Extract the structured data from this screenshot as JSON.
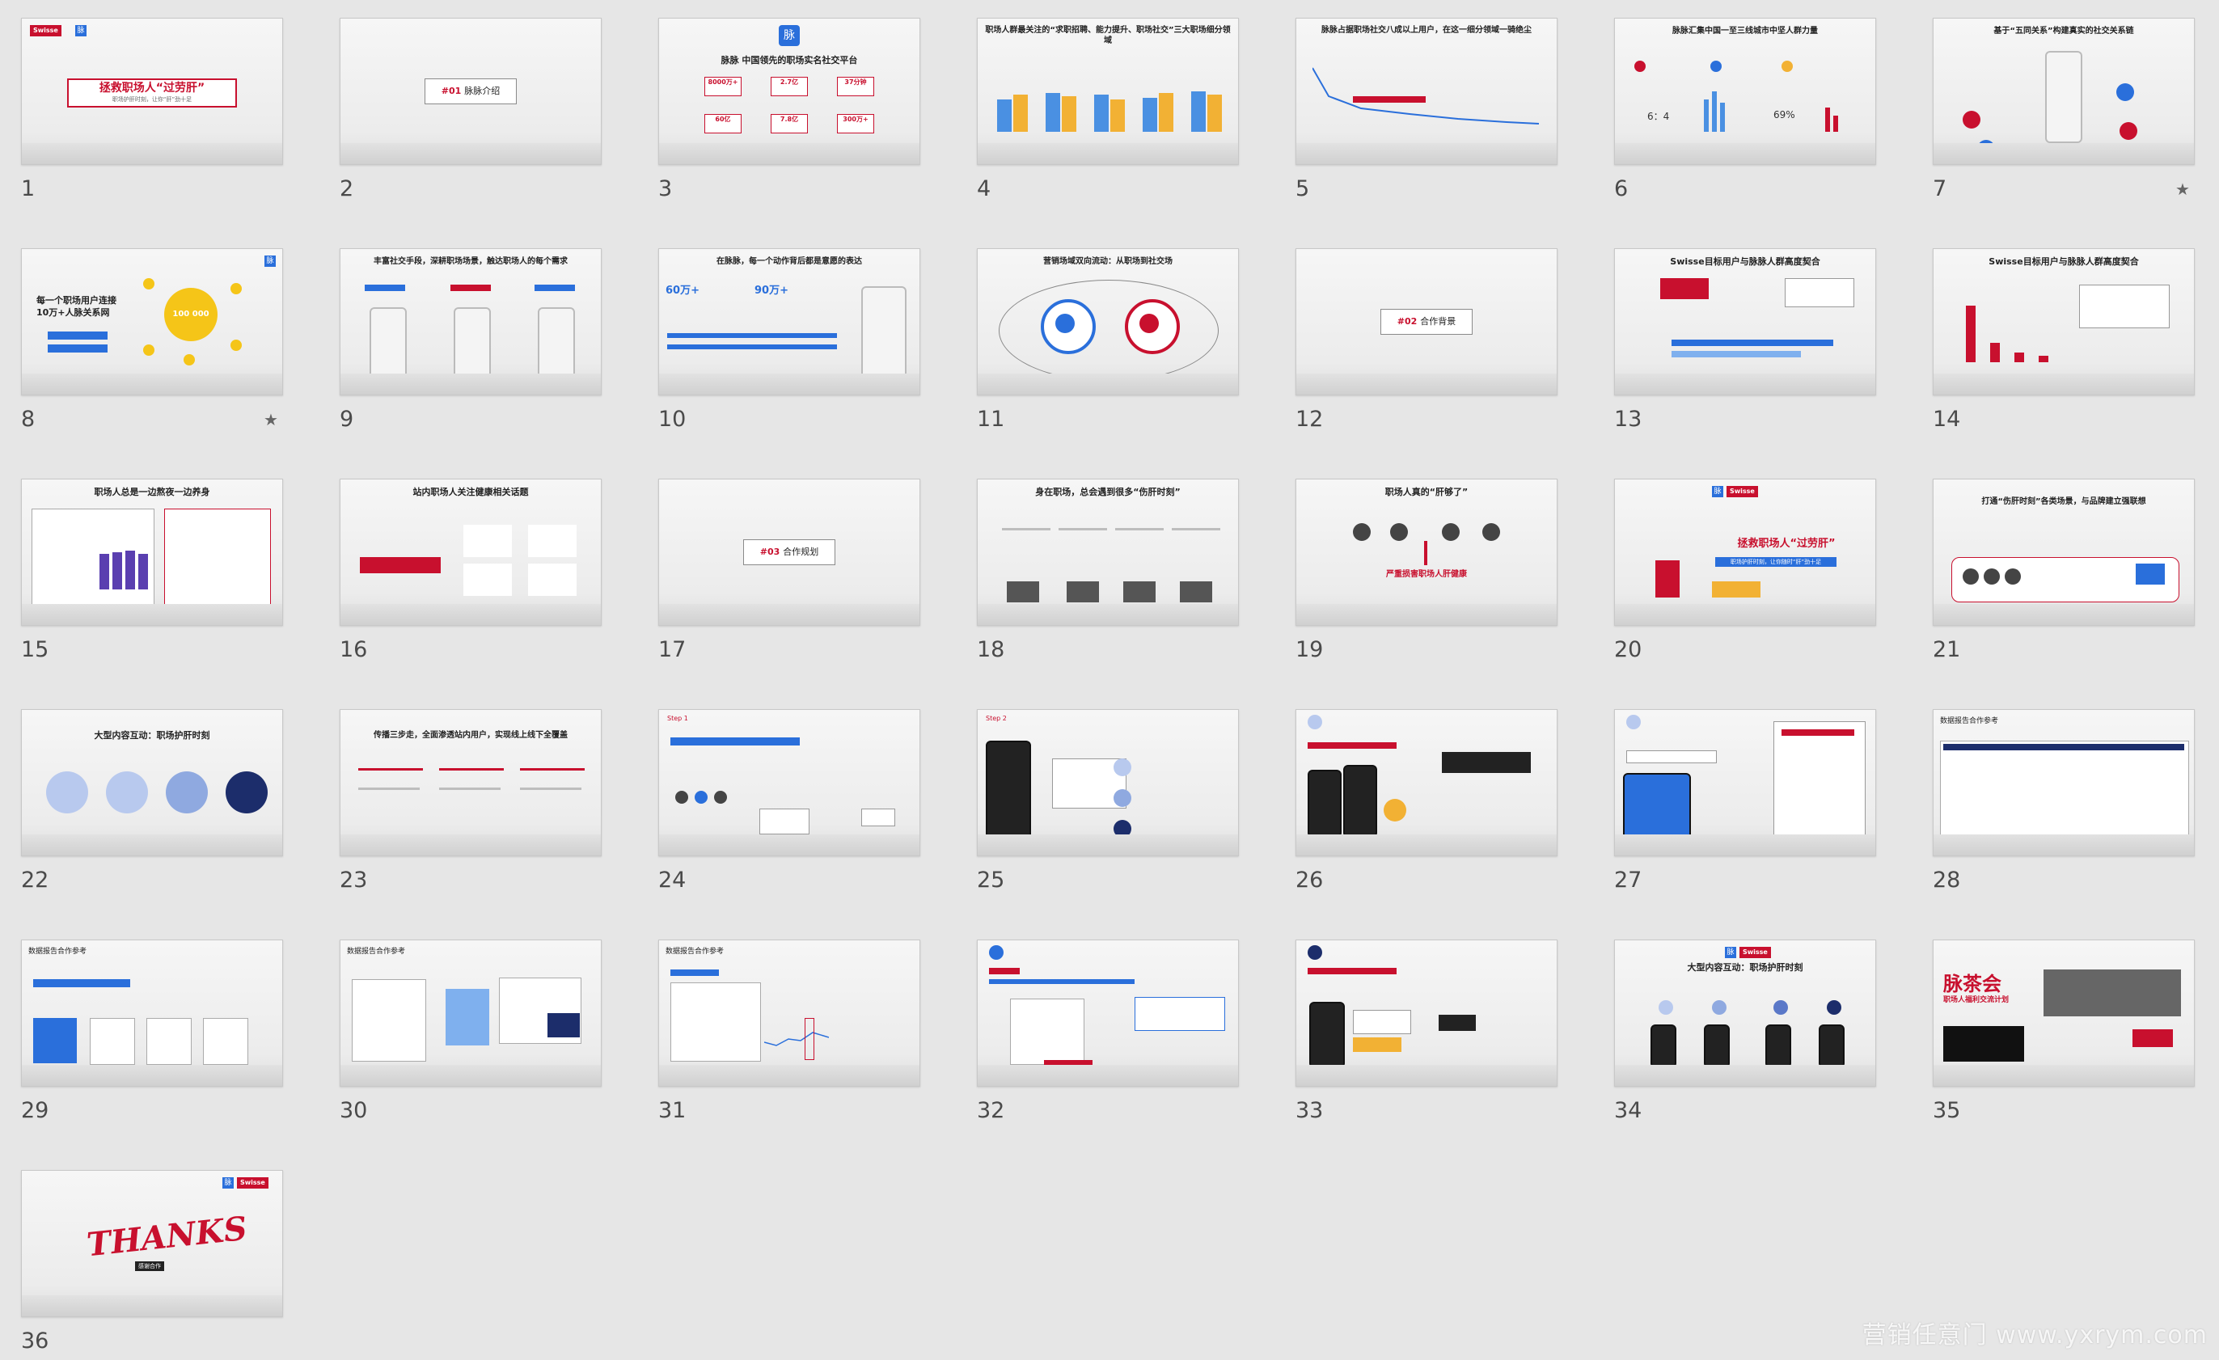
{
  "slides": [
    {
      "n": "1",
      "title": "拯救职场人“过劳肝”",
      "subtitle": "职场护肝时刻，让你“肝”劲十足"
    },
    {
      "n": "2",
      "section_no": "#01",
      "section": "脉脉介绍"
    },
    {
      "n": "3",
      "title": "脉脉 中国领先的职场实名社交平台",
      "stats": [
        "8000万+",
        "2.7亿",
        "37分钟",
        "60亿",
        "7.8亿",
        "300万+"
      ]
    },
    {
      "n": "4",
      "title": "职场人群最关注的“求职招聘、能力提升、职场社交”三大职场细分领域"
    },
    {
      "n": "5",
      "title": "脉脉占据职场社交八成以上用户，在这一细分领域一骑绝尘"
    },
    {
      "n": "6",
      "title": "脉脉汇集中国一至三线城市中坚人群力量",
      "stats": [
        "6：4",
        "69%"
      ]
    },
    {
      "n": "7",
      "title": "基于“五同关系”构建真实的社交关系链"
    },
    {
      "n": "8",
      "title": "每一个职场用户连接 10万+人脉关系网",
      "stats": [
        "100 000"
      ]
    },
    {
      "n": "9",
      "title": "丰富社交手段，深耕职场场景，触达职场人的每个需求"
    },
    {
      "n": "10",
      "title": "在脉脉，每一个动作背后都是意愿的表达",
      "stats": [
        "60万+",
        "90万+"
      ]
    },
    {
      "n": "11",
      "title": "营销场域双向流动：从职场到社交场"
    },
    {
      "n": "12",
      "section_no": "#02",
      "section": "合作背景"
    },
    {
      "n": "13",
      "title": "Swisse目标用户与脉脉人群高度契合"
    },
    {
      "n": "14",
      "title": "Swisse目标用户与脉脉人群高度契合"
    },
    {
      "n": "15",
      "title": "职场人总是一边熬夜一边养身"
    },
    {
      "n": "16",
      "title": "站内职场人关注健康相关话题"
    },
    {
      "n": "17",
      "section_no": "#03",
      "section": "合作规划"
    },
    {
      "n": "18",
      "title": "身在职场，总会遇到很多“伤肝时刻”"
    },
    {
      "n": "19",
      "title": "职场人真的“肝够了”",
      "subtitle": "严重损害职场人肝健康"
    },
    {
      "n": "20",
      "title": "拯救职场人“过劳肝”",
      "subtitle": "职场护肝时刻，让你随时“肝”劲十足"
    },
    {
      "n": "21",
      "title": "打通“伤肝时刻”各类场景，与品牌建立强联想"
    },
    {
      "n": "22",
      "title": "大型内容互动：职场护肝时刻"
    },
    {
      "n": "23",
      "title": "传播三步走，全面渗透站内用户，实现线上线下全覆盖"
    },
    {
      "n": "24",
      "title": "Step 1"
    },
    {
      "n": "25",
      "title": "Step 2"
    },
    {
      "n": "26",
      "title": ""
    },
    {
      "n": "27",
      "title": ""
    },
    {
      "n": "28",
      "title": "数据报告合作参考"
    },
    {
      "n": "29",
      "title": "数据报告合作参考"
    },
    {
      "n": "30",
      "title": "数据报告合作参考"
    },
    {
      "n": "31",
      "title": "数据报告合作参考"
    },
    {
      "n": "32",
      "title": ""
    },
    {
      "n": "33",
      "title": ""
    },
    {
      "n": "34",
      "title": "大型内容互动：职场护肝时刻"
    },
    {
      "n": "35",
      "title": "脉茶会",
      "subtitle": "职场人福利交流计划"
    },
    {
      "n": "36",
      "title": "THANKS",
      "subtitle": "感谢合作"
    }
  ],
  "brand": {
    "swisse": "Swisse",
    "maimai": "脉"
  },
  "watermark": "营销任意门 www.yxrym.com",
  "colors": {
    "accent_red": "#c8102e",
    "accent_blue": "#2a6fdb",
    "bg": "#e6e6e6"
  }
}
